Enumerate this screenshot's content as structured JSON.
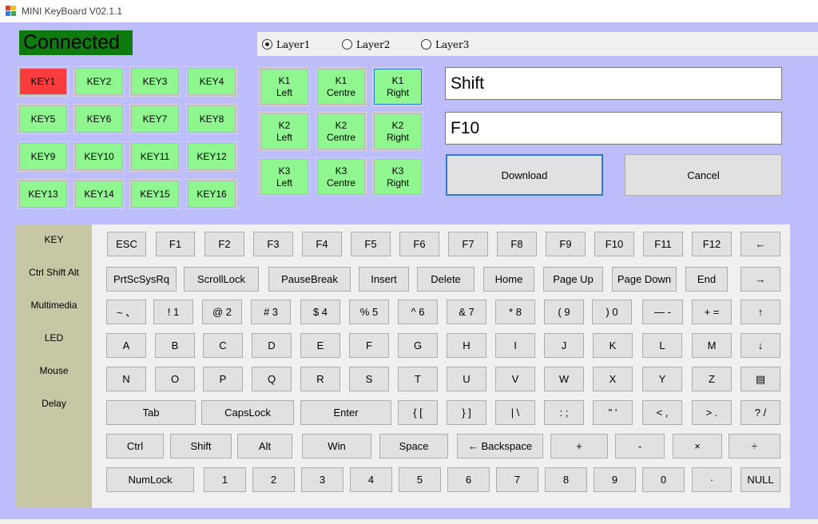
{
  "window": {
    "title": "MINI KeyBoard V02.1.1",
    "icon": "app-icon"
  },
  "status": {
    "text": "Connected",
    "color": "#0f7a0f"
  },
  "layers": {
    "options": [
      "Layer1",
      "Layer2",
      "Layer3"
    ],
    "selected": "Layer1"
  },
  "key_grid": {
    "labels": [
      "KEY1",
      "KEY2",
      "KEY3",
      "KEY4",
      "KEY5",
      "KEY6",
      "KEY7",
      "KEY8",
      "KEY9",
      "KEY10",
      "KEY11",
      "KEY12",
      "KEY13",
      "KEY14",
      "KEY15",
      "KEY16"
    ],
    "active": "KEY1",
    "active_color": "#fb3c3c",
    "idle_color": "#90f790"
  },
  "knob_grid": {
    "labels": [
      "K1\nLeft",
      "K1\nCentre",
      "K1\nRight",
      "K2\nLeft",
      "K2\nCentre",
      "K2\nRight",
      "K3\nLeft",
      "K3\nCentre",
      "K3\nRight"
    ],
    "selected": "K1\nRight"
  },
  "fields": {
    "modifier_value": "Shift",
    "key_value": "F10"
  },
  "actions": {
    "download_label": "Download",
    "cancel_label": "Cancel"
  },
  "categories": [
    "KEY",
    "Ctrl Shift Alt",
    "Multimedia",
    "LED",
    "Mouse",
    "Delay"
  ],
  "keyboard": {
    "row1": [
      "ESC",
      "F1",
      "F2",
      "F3",
      "F4",
      "F5",
      "F6",
      "F7",
      "F8",
      "F9",
      "F10",
      "F11",
      "F12",
      "←"
    ],
    "row2": [
      "PrtScSysRq",
      "ScrollLock",
      "PauseBreak",
      "Insert",
      "Delete",
      "Home",
      "Page Up",
      "Page Down",
      "End",
      "→"
    ],
    "row3": [
      "~ 、",
      "! 1",
      "@ 2",
      "# 3",
      "$ 4",
      "% 5",
      "^ 6",
      "& 7",
      "* 8",
      "( 9",
      ") 0",
      "— -",
      "+ =",
      "↑"
    ],
    "row4": [
      "A",
      "B",
      "C",
      "D",
      "E",
      "F",
      "G",
      "H",
      "I",
      "J",
      "K",
      "L",
      "M",
      "↓"
    ],
    "row5": [
      "N",
      "O",
      "P",
      "Q",
      "R",
      "S",
      "T",
      "U",
      "V",
      "W",
      "X",
      "Y",
      "Z",
      "▤"
    ],
    "row6": [
      "Tab",
      "CapsLock",
      "Enter",
      "{ [",
      "} ]",
      "| \\",
      ": ;",
      "\" '",
      "< ,",
      "> .",
      "? /"
    ],
    "row7": [
      "Ctrl",
      "Shift",
      "Alt",
      "Win",
      "Space",
      "← Backspace",
      "+",
      "-",
      "×",
      "÷"
    ],
    "row8": [
      "NumLock",
      "1",
      "2",
      "3",
      "4",
      "5",
      "6",
      "7",
      "8",
      "9",
      "0",
      "·",
      "NULL"
    ]
  }
}
